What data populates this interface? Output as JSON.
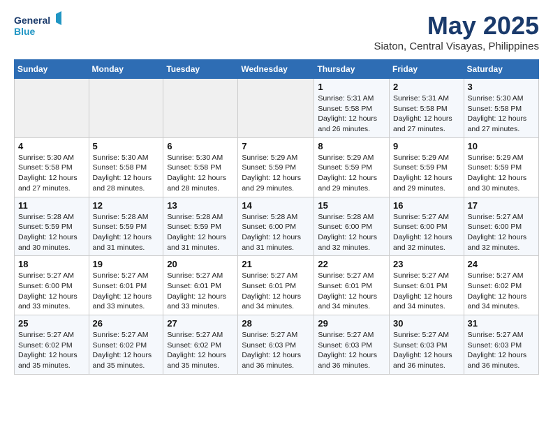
{
  "header": {
    "logo_line1": "General",
    "logo_line2": "Blue",
    "title": "May 2025",
    "subtitle": "Siaton, Central Visayas, Philippines"
  },
  "weekdays": [
    "Sunday",
    "Monday",
    "Tuesday",
    "Wednesday",
    "Thursday",
    "Friday",
    "Saturday"
  ],
  "weeks": [
    [
      {
        "day": "",
        "info": ""
      },
      {
        "day": "",
        "info": ""
      },
      {
        "day": "",
        "info": ""
      },
      {
        "day": "",
        "info": ""
      },
      {
        "day": "1",
        "info": "Sunrise: 5:31 AM\nSunset: 5:58 PM\nDaylight: 12 hours\nand 26 minutes."
      },
      {
        "day": "2",
        "info": "Sunrise: 5:31 AM\nSunset: 5:58 PM\nDaylight: 12 hours\nand 27 minutes."
      },
      {
        "day": "3",
        "info": "Sunrise: 5:30 AM\nSunset: 5:58 PM\nDaylight: 12 hours\nand 27 minutes."
      }
    ],
    [
      {
        "day": "4",
        "info": "Sunrise: 5:30 AM\nSunset: 5:58 PM\nDaylight: 12 hours\nand 27 minutes."
      },
      {
        "day": "5",
        "info": "Sunrise: 5:30 AM\nSunset: 5:58 PM\nDaylight: 12 hours\nand 28 minutes."
      },
      {
        "day": "6",
        "info": "Sunrise: 5:30 AM\nSunset: 5:58 PM\nDaylight: 12 hours\nand 28 minutes."
      },
      {
        "day": "7",
        "info": "Sunrise: 5:29 AM\nSunset: 5:59 PM\nDaylight: 12 hours\nand 29 minutes."
      },
      {
        "day": "8",
        "info": "Sunrise: 5:29 AM\nSunset: 5:59 PM\nDaylight: 12 hours\nand 29 minutes."
      },
      {
        "day": "9",
        "info": "Sunrise: 5:29 AM\nSunset: 5:59 PM\nDaylight: 12 hours\nand 29 minutes."
      },
      {
        "day": "10",
        "info": "Sunrise: 5:29 AM\nSunset: 5:59 PM\nDaylight: 12 hours\nand 30 minutes."
      }
    ],
    [
      {
        "day": "11",
        "info": "Sunrise: 5:28 AM\nSunset: 5:59 PM\nDaylight: 12 hours\nand 30 minutes."
      },
      {
        "day": "12",
        "info": "Sunrise: 5:28 AM\nSunset: 5:59 PM\nDaylight: 12 hours\nand 31 minutes."
      },
      {
        "day": "13",
        "info": "Sunrise: 5:28 AM\nSunset: 5:59 PM\nDaylight: 12 hours\nand 31 minutes."
      },
      {
        "day": "14",
        "info": "Sunrise: 5:28 AM\nSunset: 6:00 PM\nDaylight: 12 hours\nand 31 minutes."
      },
      {
        "day": "15",
        "info": "Sunrise: 5:28 AM\nSunset: 6:00 PM\nDaylight: 12 hours\nand 32 minutes."
      },
      {
        "day": "16",
        "info": "Sunrise: 5:27 AM\nSunset: 6:00 PM\nDaylight: 12 hours\nand 32 minutes."
      },
      {
        "day": "17",
        "info": "Sunrise: 5:27 AM\nSunset: 6:00 PM\nDaylight: 12 hours\nand 32 minutes."
      }
    ],
    [
      {
        "day": "18",
        "info": "Sunrise: 5:27 AM\nSunset: 6:00 PM\nDaylight: 12 hours\nand 33 minutes."
      },
      {
        "day": "19",
        "info": "Sunrise: 5:27 AM\nSunset: 6:01 PM\nDaylight: 12 hours\nand 33 minutes."
      },
      {
        "day": "20",
        "info": "Sunrise: 5:27 AM\nSunset: 6:01 PM\nDaylight: 12 hours\nand 33 minutes."
      },
      {
        "day": "21",
        "info": "Sunrise: 5:27 AM\nSunset: 6:01 PM\nDaylight: 12 hours\nand 34 minutes."
      },
      {
        "day": "22",
        "info": "Sunrise: 5:27 AM\nSunset: 6:01 PM\nDaylight: 12 hours\nand 34 minutes."
      },
      {
        "day": "23",
        "info": "Sunrise: 5:27 AM\nSunset: 6:01 PM\nDaylight: 12 hours\nand 34 minutes."
      },
      {
        "day": "24",
        "info": "Sunrise: 5:27 AM\nSunset: 6:02 PM\nDaylight: 12 hours\nand 34 minutes."
      }
    ],
    [
      {
        "day": "25",
        "info": "Sunrise: 5:27 AM\nSunset: 6:02 PM\nDaylight: 12 hours\nand 35 minutes."
      },
      {
        "day": "26",
        "info": "Sunrise: 5:27 AM\nSunset: 6:02 PM\nDaylight: 12 hours\nand 35 minutes."
      },
      {
        "day": "27",
        "info": "Sunrise: 5:27 AM\nSunset: 6:02 PM\nDaylight: 12 hours\nand 35 minutes."
      },
      {
        "day": "28",
        "info": "Sunrise: 5:27 AM\nSunset: 6:03 PM\nDaylight: 12 hours\nand 36 minutes."
      },
      {
        "day": "29",
        "info": "Sunrise: 5:27 AM\nSunset: 6:03 PM\nDaylight: 12 hours\nand 36 minutes."
      },
      {
        "day": "30",
        "info": "Sunrise: 5:27 AM\nSunset: 6:03 PM\nDaylight: 12 hours\nand 36 minutes."
      },
      {
        "day": "31",
        "info": "Sunrise: 5:27 AM\nSunset: 6:03 PM\nDaylight: 12 hours\nand 36 minutes."
      }
    ]
  ]
}
